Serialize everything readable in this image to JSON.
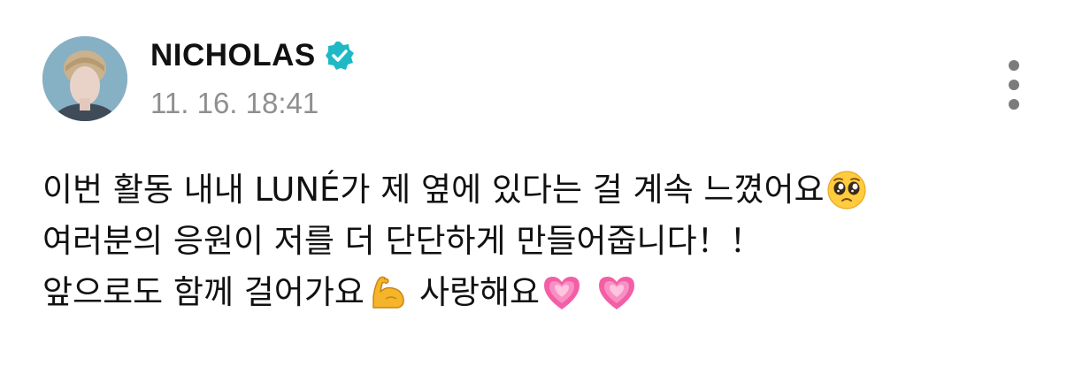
{
  "post": {
    "author": "NICHOLAS",
    "verified": true,
    "timestamp": "11. 16. 18:41",
    "lines": [
      {
        "text": "이번 활동 내내 LUNÉ가 제 옆에 있다는 걸 계속 느꼈어요",
        "emoji": [
          "pleading-face-icon"
        ]
      },
      {
        "text": "여러분의 응원이 저를 더 단단하게 만들어줍니다！！",
        "emoji": []
      },
      {
        "text_before": "앞으로도 함께 걸어가요",
        "emoji_mid": "flexed-biceps-icon",
        "text_after": "사랑해요",
        "emoji": [
          "growing-heart-icon",
          "growing-heart-icon"
        ]
      }
    ]
  },
  "colors": {
    "verified_badge": "#1fb9c6",
    "timestamp": "#8f8f8f",
    "more_dots": "#7b7b7b",
    "heart": "#f35fa6",
    "biceps": "#f5b52a"
  },
  "icons": {
    "more": "vertical-ellipsis-icon"
  }
}
